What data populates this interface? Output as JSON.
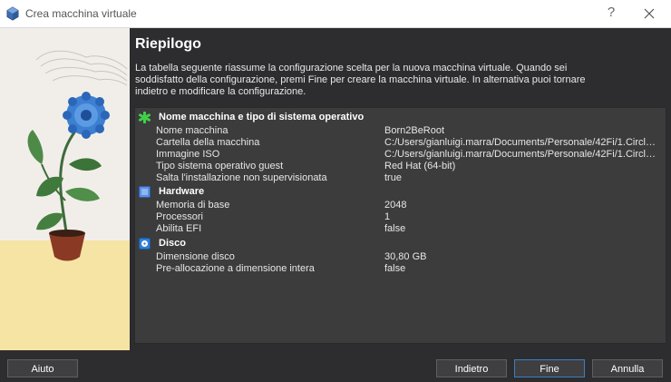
{
  "window": {
    "title": "Crea macchina virtuale",
    "help_glyph": "?"
  },
  "main": {
    "heading": "Riepilogo",
    "description": "La tabella seguente riassume la configurazione scelta per la nuova macchina virtuale. Quando sei soddisfatto della configurazione, premi Fine per creare la macchina virtuale. In alternativa puoi tornare indietro e modificare la configurazione."
  },
  "summary": {
    "sections": [
      {
        "title": "Nome macchina e tipo di sistema operativo",
        "icon": "green-star-icon",
        "rows": [
          {
            "key": "Nome macchina",
            "value": "Born2BeRoot"
          },
          {
            "key": "Cartella della macchina",
            "value": "C:/Users/gianluigi.marra/Documents/Personale/42Fi/1.Circle/..."
          },
          {
            "key": "Immagine ISO",
            "value": "C:/Users/gianluigi.marra/Documents/Personale/42Fi/1.Circle/..."
          },
          {
            "key": "Tipo sistema operativo guest",
            "value": "Red Hat (64-bit)"
          },
          {
            "key": "Salta l'installazione non supervisionata",
            "value": "true"
          }
        ]
      },
      {
        "title": "Hardware",
        "icon": "hardware-chip-icon",
        "rows": [
          {
            "key": "Memoria di base",
            "value": "2048"
          },
          {
            "key": "Processori",
            "value": "1"
          },
          {
            "key": "Abilita EFI",
            "value": "false"
          }
        ]
      },
      {
        "title": "Disco",
        "icon": "disk-icon",
        "rows": [
          {
            "key": "Dimensione disco",
            "value": "30,80 GB"
          },
          {
            "key": "Pre-allocazione a dimensione intera",
            "value": "false"
          }
        ]
      }
    ]
  },
  "buttons": {
    "help": "Aiuto",
    "back": "Indietro",
    "finish": "Fine",
    "cancel": "Annulla"
  },
  "colors": {
    "background": "#2d2d30",
    "panel": "#3c3c3c",
    "accent": "#3a7fc1"
  }
}
